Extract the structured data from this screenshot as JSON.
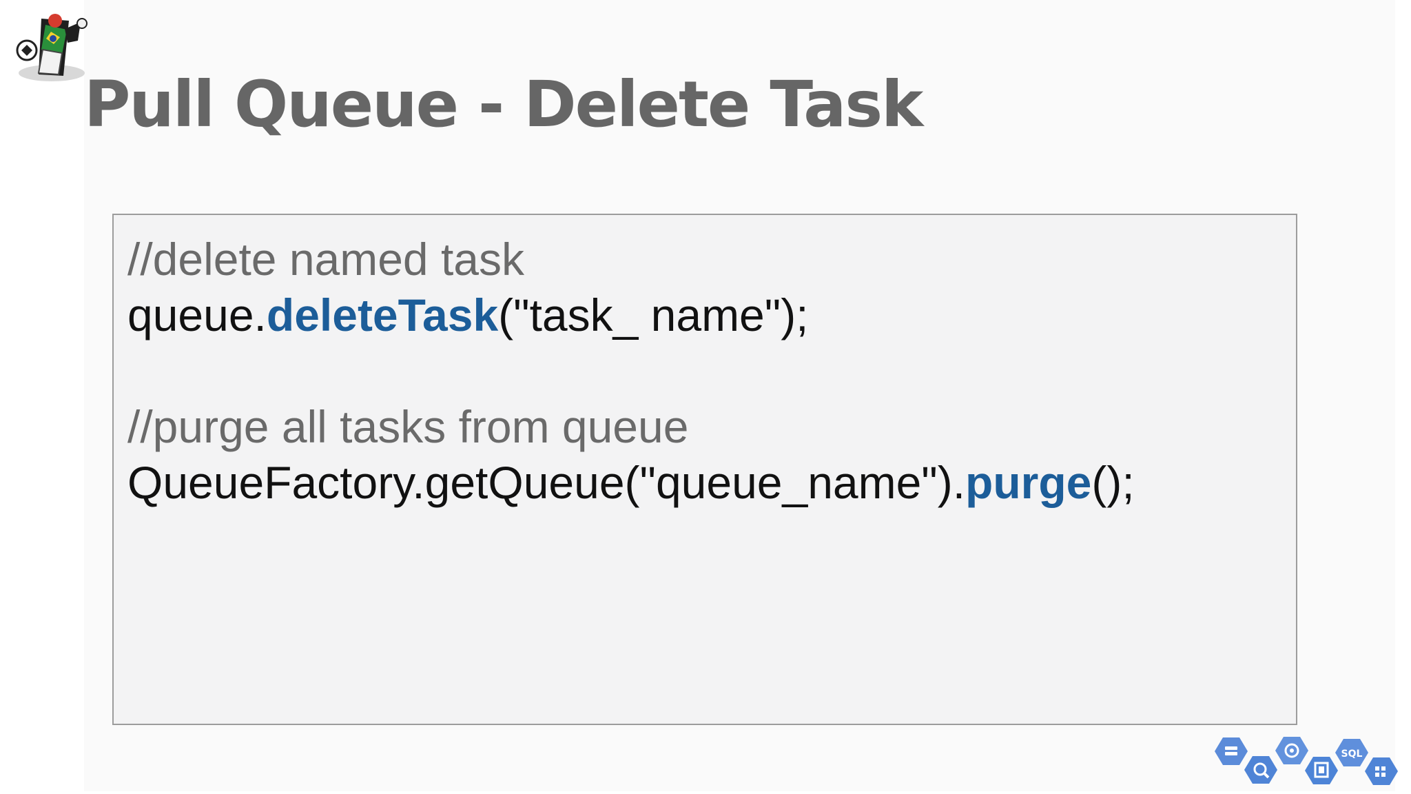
{
  "slide": {
    "title": "Pull Queue - Delete Task",
    "code": {
      "comment_delete": "//delete named task",
      "delete_prefix": "queue.",
      "delete_method": "deleteTask",
      "delete_suffix": "(\"task_ name\");",
      "comment_purge": "//purge all tasks from queue",
      "purge_prefix": "QueueFactory.getQueue(\"queue_name\").",
      "purge_method": "purge",
      "purge_suffix": "();"
    }
  },
  "icons": {
    "logo": "mascot-icon",
    "cloud_services": [
      "storage-icon",
      "bigquery-icon",
      "app-engine-icon",
      "compute-engine-icon",
      "cloud-sql-icon",
      "datastore-icon"
    ],
    "sql_label": "SQL"
  },
  "colors": {
    "title": "#666666",
    "comment": "#6a6a6a",
    "code": "#111111",
    "method": "#1c5d99",
    "code_background": "#f3f3f4",
    "code_border": "#9c9c9c",
    "cloud_hex": "#5b8bd9"
  }
}
